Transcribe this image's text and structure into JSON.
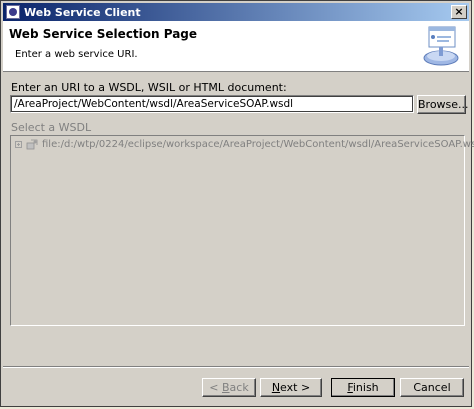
{
  "window": {
    "title": "Web Service Client",
    "close_glyph": "×"
  },
  "header": {
    "title": "Web Service Selection Page",
    "description": "Enter a web service URI.",
    "graphic_icon": "wsdl-banner-icon"
  },
  "uri": {
    "label": "Enter an URI to a WSDL, WSIL or HTML document:",
    "value": "/AreaProject/WebContent/wsdl/AreaServiceSOAP.wsdl",
    "browse_label": "Browse..."
  },
  "wsdl": {
    "label": "Select a WSDL",
    "tree_items": [
      {
        "label": "file:/d:/wtp/0224/eclipse/workspace/AreaProject/WebContent/wsdl/AreaServiceSOAP.wsdl",
        "icon": "wsdl-file-icon"
      }
    ]
  },
  "buttons": {
    "back_pre": "< ",
    "back_u": "B",
    "back_post": "ack",
    "next_u": "N",
    "next_post": "ext >",
    "finish_u": "F",
    "finish_post": "inish",
    "cancel": "Cancel"
  },
  "colors": {
    "title_start": "#0a246a",
    "title_end": "#a6caf0",
    "dialog_bg": "#d4d0c8"
  }
}
